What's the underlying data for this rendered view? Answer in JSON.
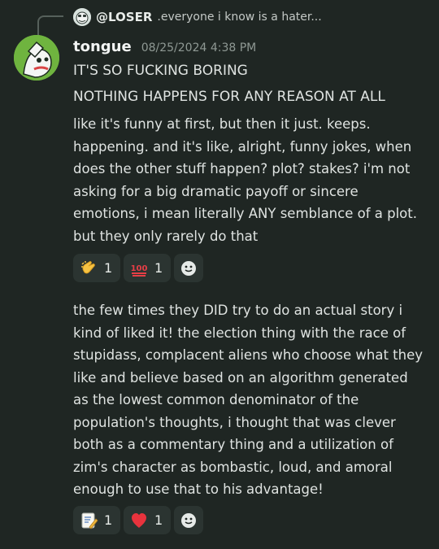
{
  "colors": {
    "background": "#1f2623",
    "text": "#dfe3e1",
    "muted": "#8f9994",
    "reaction_bg": "#2b3431",
    "avatar_green": "#6fb43f",
    "heart_red": "#e8333d",
    "hundred_red": "#e63e46"
  },
  "reply": {
    "username": "@LOSER",
    "preview": ".everyone i know is a hater..."
  },
  "message": {
    "author": "tongue",
    "timestamp": "08/25/2024 4:38 PM",
    "line1": "IT'S SO FUCKING BORING",
    "line2": "NOTHING HAPPENS FOR ANY REASON AT ALL",
    "paragraph1": "like it's funny at first, but then it just. keeps. happening. and it's like, alright, funny jokes, when does the other stuff happen? plot? stakes? i'm not asking for a big dramatic payoff or sincere emotions, i mean literally ANY semblance of a plot. but they only rarely do that",
    "paragraph2": "the few times they DID try to do an actual story i kind of liked it! the election thing with the race of stupidass, complacent aliens who choose what they like and believe based on an algorithm generated as the lowest common denominator of the population's thoughts, i thought that was clever both as a commentary thing and a utilization of zim's character as bombastic, loud, and amoral enough to use that to his advantage!"
  },
  "reactions1": [
    {
      "emoji": "clapping-hands-icon",
      "count": "1"
    },
    {
      "emoji": "hundred-points-icon",
      "count": "1"
    }
  ],
  "reactions2": [
    {
      "emoji": "memo-icon",
      "count": "1"
    },
    {
      "emoji": "red-heart-icon",
      "count": "1"
    }
  ]
}
